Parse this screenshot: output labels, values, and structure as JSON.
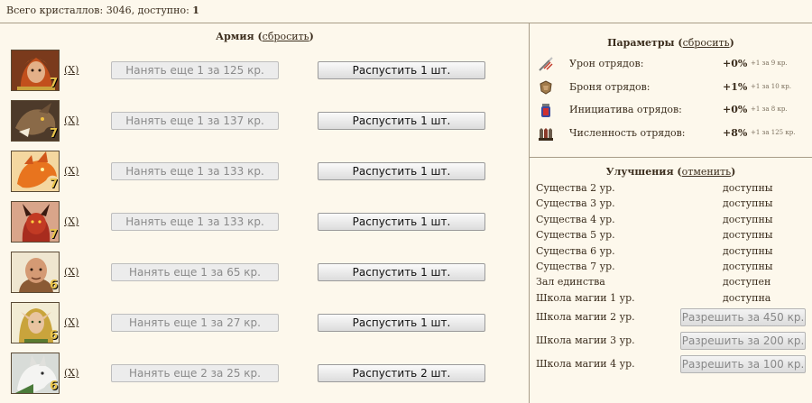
{
  "header": {
    "crystals_label": "Всего кристаллов: ",
    "crystals_total": "3046",
    "available_label": ", доступно: ",
    "available": "1"
  },
  "army": {
    "title": "Армия",
    "reset_open": " (",
    "reset_link": "сбросить",
    "reset_close": ")",
    "units": [
      {
        "portrait": "red-haired-warrior-portrait",
        "tier": "7",
        "remove": "(X)",
        "hire": "Нанять еще 1 за 125 кр.",
        "dismiss": "Распустить 1 шт."
      },
      {
        "portrait": "bronze-dragon-portrait",
        "tier": "7",
        "remove": "(X)",
        "hire": "Нанять еще 1 за 137 кр.",
        "dismiss": "Распустить 1 шт."
      },
      {
        "portrait": "fire-dragon-portrait",
        "tier": "7",
        "remove": "(X)",
        "hire": "Нанять еще 1 за 133 кр.",
        "dismiss": "Распустить 1 шт."
      },
      {
        "portrait": "red-demon-portrait",
        "tier": "7",
        "remove": "(X)",
        "hire": "Нанять еще 1 за 133 кр.",
        "dismiss": "Распустить 1 шт."
      },
      {
        "portrait": "bald-monk-portrait",
        "tier": "6",
        "remove": "(X)",
        "hire": "Нанять еще 1 за 65 кр.",
        "dismiss": "Распустить 1 шт."
      },
      {
        "portrait": "elf-druid-portrait",
        "tier": "6",
        "remove": "(X)",
        "hire": "Нанять еще 1 за 27 кр.",
        "dismiss": "Распустить 1 шт."
      },
      {
        "portrait": "white-wolf-portrait",
        "tier": "6",
        "remove": "(X)",
        "hire": "Нанять еще 2 за 25 кр.",
        "dismiss": "Распустить 2 шт."
      }
    ]
  },
  "params": {
    "title": "Параметры",
    "reset_open": " (",
    "reset_link": "сбросить",
    "reset_close": ")",
    "rows": [
      {
        "icon": "sword-damage-icon",
        "label": "Урон отрядов:",
        "value": "+0%",
        "note": "+1 за 9 кр."
      },
      {
        "icon": "armor-shield-icon",
        "label": "Броня отрядов:",
        "value": "+1%",
        "note": "+1 за 10 кр."
      },
      {
        "icon": "initiative-potion-icon",
        "label": "Инициатива отрядов:",
        "value": "+0%",
        "note": "+1 за 8 кр."
      },
      {
        "icon": "troop-count-icon",
        "label": "Численность отрядов:",
        "value": "+8%",
        "note": "+1 за 125 кр."
      }
    ]
  },
  "upgrades": {
    "title": "Улучшения",
    "cancel_open": " (",
    "cancel_link": "отменить",
    "cancel_close": ")",
    "rows": [
      {
        "name": "Существа 2 ур.",
        "status": "доступны"
      },
      {
        "name": "Существа 3 ур.",
        "status": "доступны"
      },
      {
        "name": "Существа 4 ур.",
        "status": "доступны"
      },
      {
        "name": "Существа 5 ур.",
        "status": "доступны"
      },
      {
        "name": "Существа 6 ур.",
        "status": "доступны"
      },
      {
        "name": "Существа 7 ур.",
        "status": "доступны"
      },
      {
        "name": "Зал единства",
        "status": "доступен"
      },
      {
        "name": "Школа магии 1 ур.",
        "status": "доступна"
      }
    ],
    "buy_rows": [
      {
        "name": "Школа магии 2 ур.",
        "button": "Разрешить за 450 кр."
      },
      {
        "name": "Школа магии 3 ур.",
        "button": "Разрешить за 200 кр."
      },
      {
        "name": "Школа магии 4 ур.",
        "button": "Разрешить за 100 кр."
      }
    ]
  }
}
